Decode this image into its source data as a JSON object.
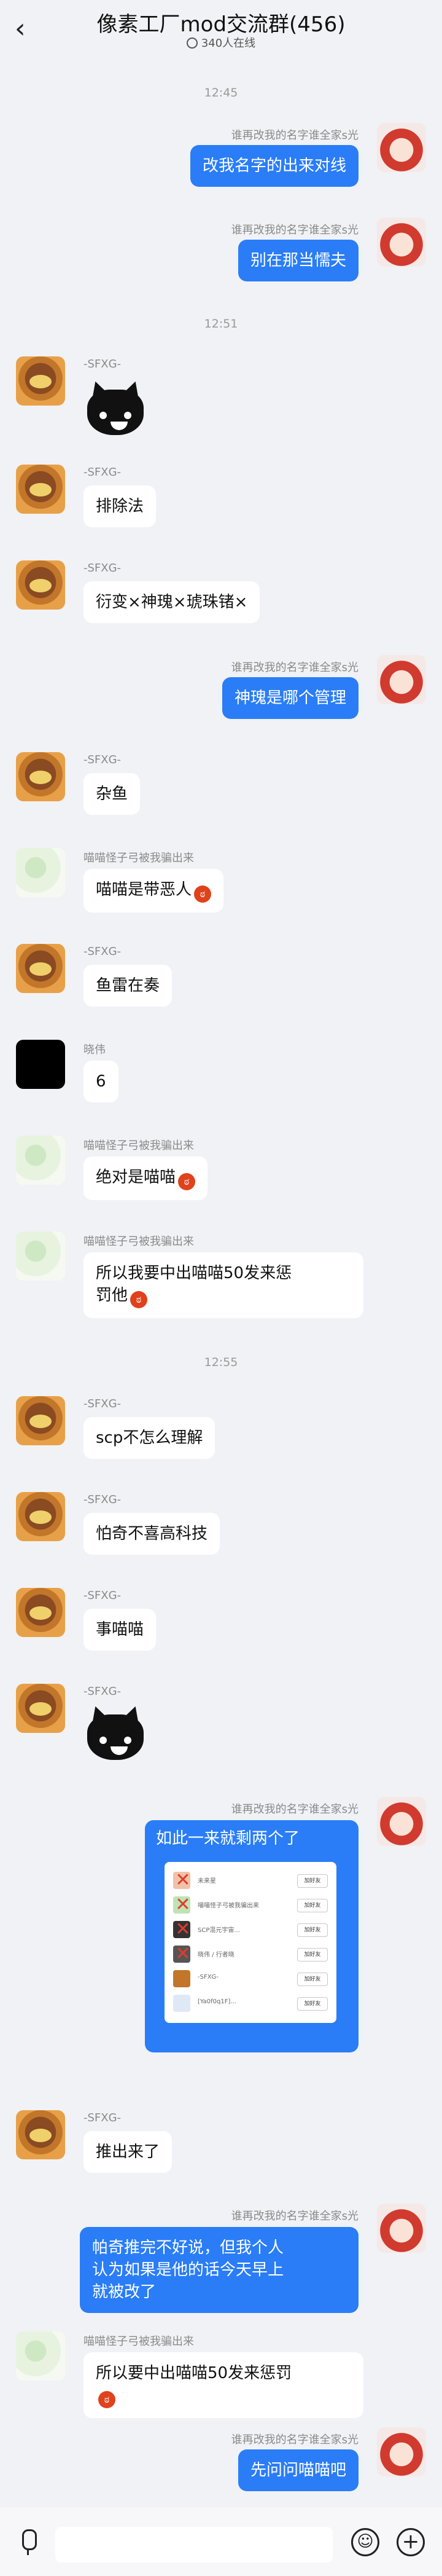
{
  "header": {
    "back_icon": "chevron-left-icon",
    "title": "像素工厂mod交流群(456)",
    "online": "340人在线"
  },
  "timestamps": [
    "12:45",
    "12:51",
    "12:55"
  ],
  "messages": [
    {
      "sender": "谁再改我的名字谁全家s光",
      "text": "改我名字的出来对线"
    },
    {
      "sender": "谁再改我的名字谁全家s光",
      "text": "别在那当懦夫"
    },
    {
      "sender": "-SFXG-"
    },
    {
      "sender": "-SFXG-",
      "text": "排除法"
    },
    {
      "sender": "-SFXG-",
      "text": "衍变×神瑰×琥珠锗×"
    },
    {
      "sender": "谁再改我的名字谁全家s光",
      "text": "神瑰是哪个管理"
    },
    {
      "sender": "-SFXG-",
      "text": "杂鱼"
    },
    {
      "sender": "喵喵怪子弓被我骗出来",
      "text": "喵喵是带恶人"
    },
    {
      "sender": "-SFXG-",
      "text": "鱼雷在奏"
    },
    {
      "sender": "晓伟",
      "text": "6"
    },
    {
      "sender": "喵喵怪子弓被我骗出来",
      "text": "绝对是喵喵"
    },
    {
      "sender": "喵喵怪子弓被我骗出来",
      "text_line1": "所以我要中出喵喵50发来惩",
      "text_line2": "罚他"
    },
    {
      "sender": "-SFXG-",
      "text": "scp不怎么理解"
    },
    {
      "sender": "-SFXG-",
      "text": "怕奇不喜高科技"
    },
    {
      "sender": "-SFXG-",
      "text": "事喵喵"
    },
    {
      "sender": "-SFXG-"
    },
    {
      "sender": "谁再改我的名字谁全家s光",
      "text": "如此一来就剩两个了"
    },
    {
      "sender": "-SFXG-",
      "text": "推出来了"
    },
    {
      "sender": "谁再改我的名字谁全家s光",
      "text_line1": "帕奇推完不好说，但我个人",
      "text_line2": "认为如果是他的话今天早上",
      "text_line3": "就被改了"
    },
    {
      "sender": "喵喵怪子弓被我骗出来",
      "text_line1": "所以要中出喵喵50发来惩罚",
      "text_line2": ""
    },
    {
      "sender": "谁再改我的名字谁全家s光",
      "text": "先问问喵喵吧"
    }
  ],
  "screenshot_card": {
    "rows": [
      {
        "name": "未来星",
        "button": "加好友",
        "mark": "x"
      },
      {
        "name": "喵喵怪子弓被我骗出来",
        "button": "加好友",
        "mark": "x"
      },
      {
        "name": "SCP混元宇宙...",
        "button": "加好友",
        "mark": "x"
      },
      {
        "name": "晓伟 / 行者晓",
        "button": "加好友",
        "mark": "x"
      },
      {
        "name": "-SFXG-",
        "button": "加好友",
        "mark": ""
      },
      {
        "name": "[Ya0f0q1F]...",
        "button": "加好友",
        "mark": ""
      }
    ]
  },
  "bottom": {
    "mic_icon": "mic-icon",
    "emoji_icon": "emoji-icon",
    "plus_icon": "plus-icon"
  }
}
